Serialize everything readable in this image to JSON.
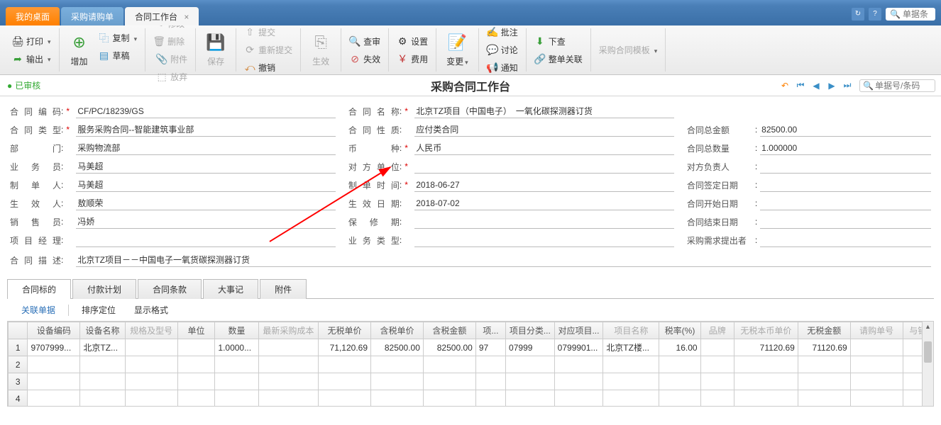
{
  "tabs": {
    "t0": "我的桌面",
    "t1": "采购请购单",
    "t2": "合同工作台"
  },
  "globalSearch": {
    "placeholder": "单据条"
  },
  "toolbar": {
    "print": "打印",
    "export": "输出",
    "add": "增加",
    "copy": "复制",
    "draft": "草稿",
    "edit": "修改",
    "delete": "删除",
    "attach": "附件",
    "drop": "放弃",
    "save": "保存",
    "submit": "提交",
    "resubmit": "重新提交",
    "revoke": "撤销",
    "gen": "生效",
    "review": "查审",
    "void": "失效",
    "setting": "设置",
    "fee": "费用",
    "change": "变更",
    "note": "批注",
    "discuss": "讨论",
    "notify": "通知",
    "down": "下查",
    "link": "整单关联",
    "template": "采购合同模板"
  },
  "status": "已审核",
  "pageTitle": "采购合同工作台",
  "docSearch": {
    "placeholder": "单据号/条码"
  },
  "form": {
    "l_code": "合同编码",
    "v_code": "CF/PC/18239/GS",
    "l_type": "合同类型",
    "v_type": "服务采购合同--智能建筑事业部",
    "l_dept": "部　　门",
    "v_dept": "采购物流部",
    "l_biz": "业 务 员",
    "v_biz": "马美超",
    "l_maker": "制 单 人",
    "v_maker": "马美超",
    "l_eff": "生 效 人",
    "v_eff": "敖顺荣",
    "l_sales": "销 售 员",
    "v_sales": "冯娇",
    "l_pm": "项目经理",
    "v_pm": "",
    "l_desc": "合同描述",
    "v_desc": "北京TZ项目－－中国电子一氧货碳探测器订货",
    "l_name": "合同名称",
    "v_name": "北京TZ项目（中国电子）　一氧化碳探测器订货",
    "l_nature": "合同性质",
    "v_nature": "应付类合同",
    "l_curr": "币　　种",
    "v_curr": "人民币",
    "l_other": "对方单位",
    "v_other": "",
    "l_mdate": "制单时间",
    "v_mdate": "2018-06-27",
    "l_edate": "生效日期",
    "v_edate": "2018-07-02",
    "l_warranty": "保 修 期",
    "v_warranty": "",
    "l_btype": "业务类型",
    "v_btype": "",
    "l_total": "合同总金额",
    "v_total": "82500.00",
    "l_qty": "合同总数量",
    "v_qty": "1.000000",
    "l_resp": "对方负责人",
    "v_resp": "",
    "l_sign": "合同签定日期",
    "v_sign": "",
    "l_start": "合同开始日期",
    "v_start": "",
    "l_end": "合同结束日期",
    "v_end": "",
    "l_req": "采购需求提出者",
    "v_req": ""
  },
  "subtabs": {
    "t0": "合同标的",
    "t1": "付款计划",
    "t2": "合同条款",
    "t3": "大事记",
    "t4": "附件"
  },
  "gridToolbar": {
    "rel": "关联单据",
    "sort": "排序定位",
    "fmt": "显示格式"
  },
  "gridHeaders": {
    "c1": "设备编码",
    "c2": "设备名称",
    "c3": "规格及型号",
    "c4": "单位",
    "c5": "数量",
    "c6": "最新采购成本",
    "c7": "无税单价",
    "c8": "含税单价",
    "c9": "含税金额",
    "c10": "项...",
    "c11": "项目分类...",
    "c12": "对应项目...",
    "c13": "项目名称",
    "c14": "税率(%)",
    "c15": "品牌",
    "c16": "无税本币单价",
    "c17": "无税金额",
    "c18": "请购单号",
    "c19": "与销"
  },
  "gridRows": [
    {
      "n": "1",
      "c1": "9707999...",
      "c2": "北京TZ...",
      "c5": "1.0000...",
      "c7": "71,120.69",
      "c8": "82500.00",
      "c9": "82500.00",
      "c10": "97",
      "c11": "07999",
      "c12": "0799901...",
      "c13": "北京TZ楼...",
      "c14": "16.00",
      "c16": "71120.69",
      "c17": "71120.69"
    },
    {
      "n": "2"
    },
    {
      "n": "3"
    },
    {
      "n": "4"
    }
  ]
}
